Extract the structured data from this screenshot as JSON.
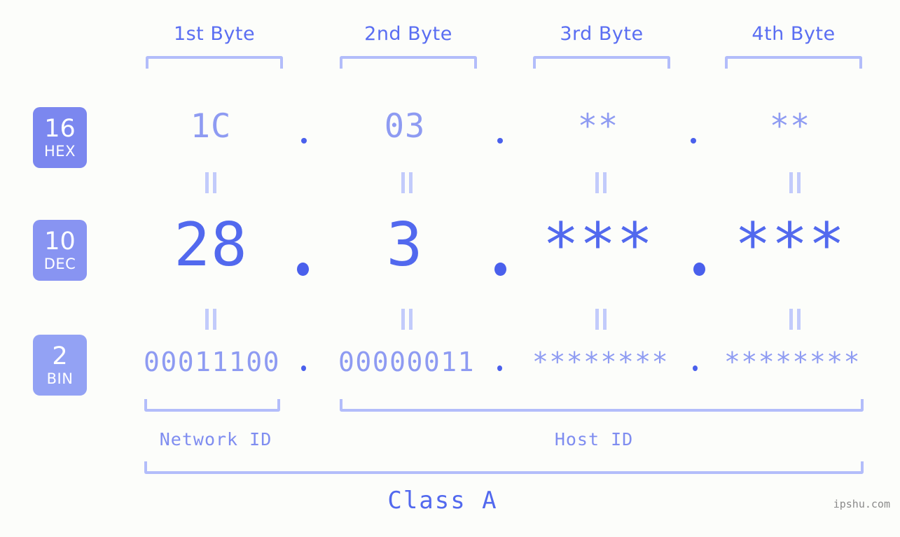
{
  "background_color": "#fcfdfa",
  "accent_colors": {
    "bracket": "#b3bdfa",
    "badge_hex": "#7b87ef",
    "badge_dec": "#8894f2",
    "badge_bin": "#93a2f4",
    "header_text": "#5a6ef2",
    "value_strong": "#5269ee",
    "value_light": "#8e9bf2",
    "segment_label": "#7f8df0",
    "watermark": "#8a8a8a"
  },
  "headers": {
    "byte1": "1st Byte",
    "byte2": "2nd Byte",
    "byte3": "3rd Byte",
    "byte4": "4th Byte"
  },
  "bases": [
    {
      "id": "hex",
      "number": "16",
      "name": "HEX"
    },
    {
      "id": "dec",
      "number": "10",
      "name": "DEC"
    },
    {
      "id": "bin",
      "number": "2",
      "name": "BIN"
    }
  ],
  "separator": ".",
  "equals_symbol": "=",
  "rows": {
    "hex": {
      "base_number": "16",
      "base_name": "HEX",
      "b1": "1C",
      "b2": "03",
      "b3": "**",
      "b4": "**"
    },
    "dec": {
      "base_number": "10",
      "base_name": "DEC",
      "b1": "28",
      "b2": "3",
      "b3": "***",
      "b4": "***"
    },
    "bin": {
      "base_number": "2",
      "base_name": "BIN",
      "b1": "00011100",
      "b2": "00000011",
      "b3": "********",
      "b4": "********"
    }
  },
  "segments": {
    "network_id": "Network ID",
    "host_id": "Host ID",
    "class": "Class A"
  },
  "watermark": "ipshu.com"
}
